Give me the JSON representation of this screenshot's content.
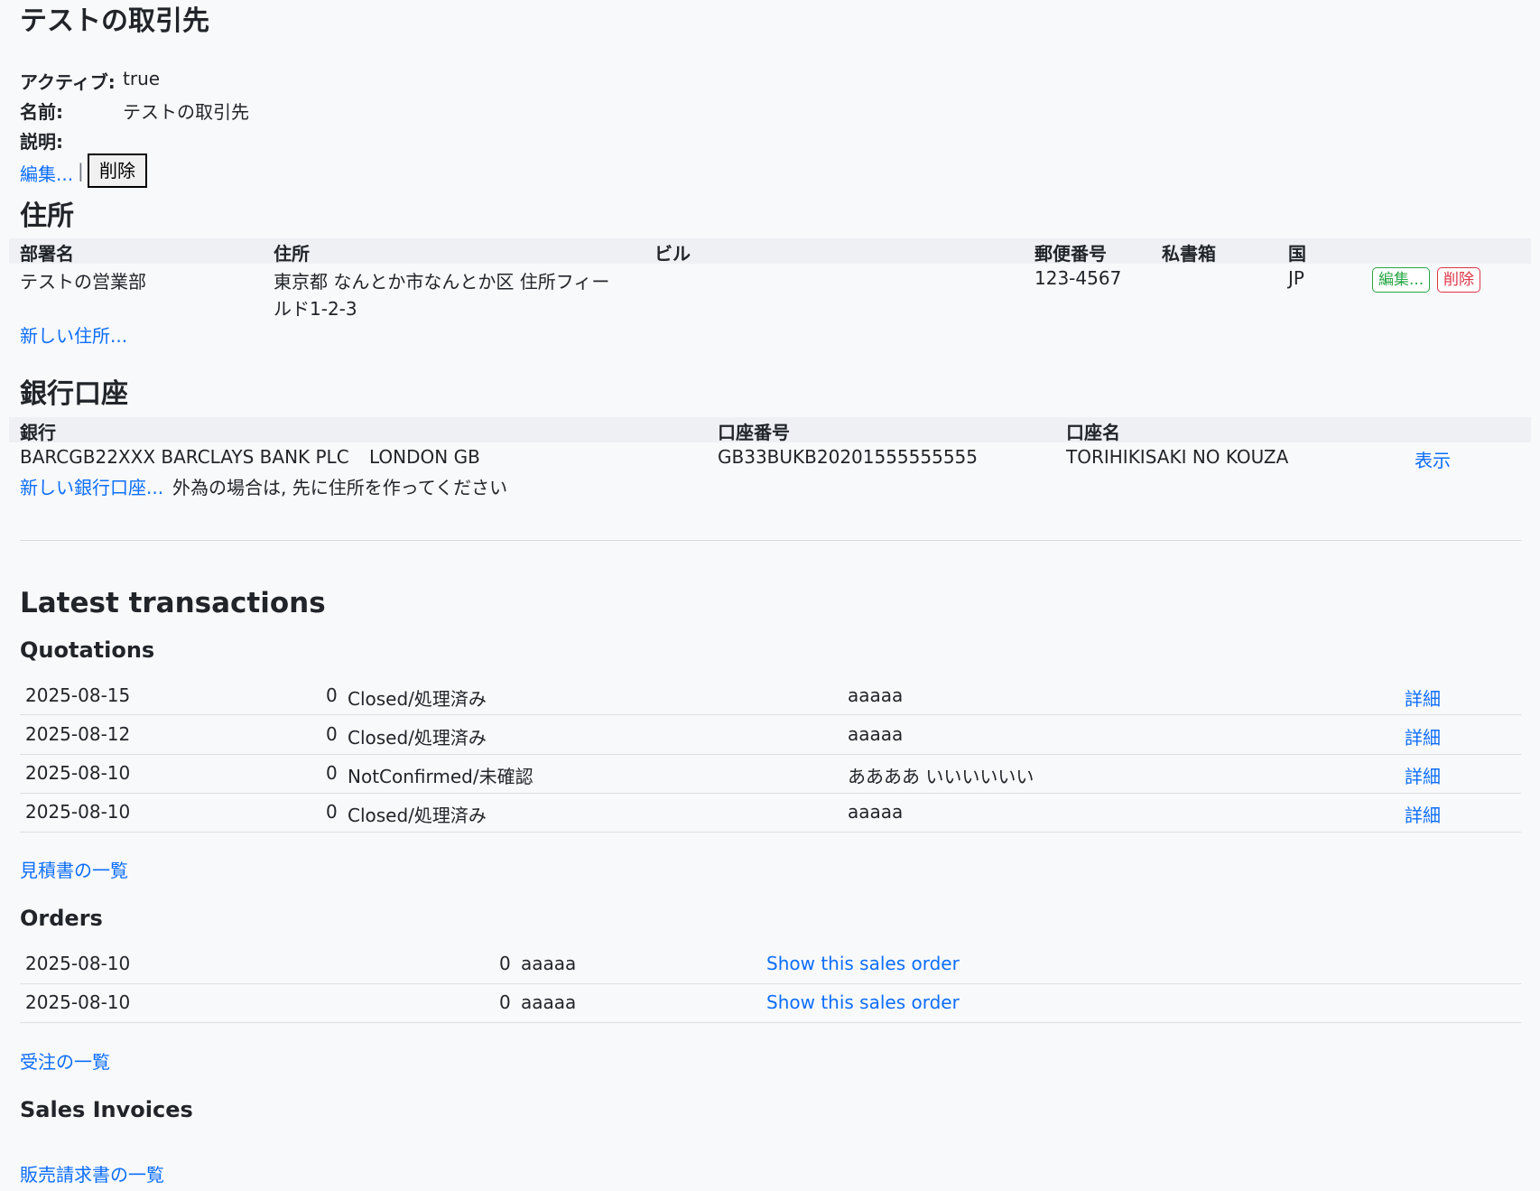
{
  "page_title": "テストの取引先",
  "details": {
    "active_label": "アクティブ:",
    "active_value": "true",
    "name_label": "名前:",
    "name_value": "テストの取引先",
    "description_label": "説明:",
    "edit_link": "編集...",
    "separator": "|",
    "delete_button": "削除"
  },
  "addresses": {
    "heading": "住所",
    "headers": [
      "部署名",
      "住所",
      "ビル",
      "郵便番号",
      "私書箱",
      "国"
    ],
    "rows": [
      {
        "department": "テストの営業部",
        "address_line1": "東京都 なんとか市なんとか区 住所フィー",
        "address_line2": "ルド1-2-3",
        "building": "",
        "postal_code": "123-4567",
        "po_box": "",
        "country": "JP",
        "edit": "編集...",
        "delete": "削除"
      }
    ],
    "new_link": "新しい住所..."
  },
  "bank_accounts": {
    "heading": "銀行口座",
    "headers": [
      "銀行",
      "口座番号",
      "口座名"
    ],
    "rows": [
      {
        "bank": "BARCGB22XXX BARCLAYS BANK PLC",
        "bank_location": "LONDON GB",
        "account_number": "GB33BUKB20201555555555",
        "account_name": "TORIHIKISAKI NO KOUZA",
        "show": "表示"
      }
    ],
    "new_link": "新しい銀行口座...",
    "note": "外為の場合は, 先に住所を作ってください"
  },
  "transactions": {
    "heading": "Latest transactions",
    "quotations": {
      "heading": "Quotations",
      "rows": [
        {
          "date": "2025-08-15",
          "amount": "0",
          "status": "Closed/処理済み",
          "subject": "aaaaa",
          "link": "詳細"
        },
        {
          "date": "2025-08-12",
          "amount": "0",
          "status": "Closed/処理済み",
          "subject": "aaaaa",
          "link": "詳細"
        },
        {
          "date": "2025-08-10",
          "amount": "0",
          "status": "NotConfirmed/未確認",
          "subject": "ああああ いいいいいい",
          "link": "詳細"
        },
        {
          "date": "2025-08-10",
          "amount": "0",
          "status": "Closed/処理済み",
          "subject": "aaaaa",
          "link": "詳細"
        }
      ],
      "list_link": "見積書の一覧"
    },
    "orders": {
      "heading": "Orders",
      "rows": [
        {
          "date": "2025-08-10",
          "amount": "0",
          "subject": "aaaaa",
          "link": "Show this sales order"
        },
        {
          "date": "2025-08-10",
          "amount": "0",
          "subject": "aaaaa",
          "link": "Show this sales order"
        }
      ],
      "list_link": "受注の一覧"
    },
    "sales_invoices": {
      "heading": "Sales Invoices",
      "list_link": "販売請求書の一覧"
    }
  }
}
